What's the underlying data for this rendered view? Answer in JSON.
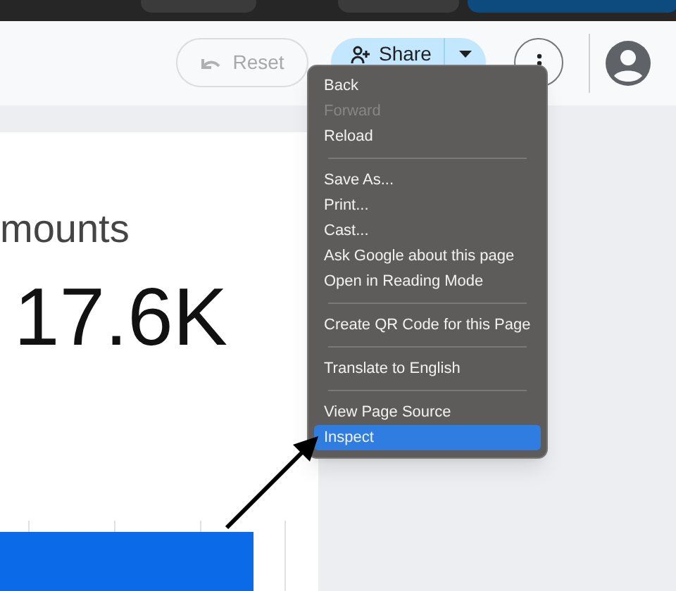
{
  "toolbar": {
    "reset_button": {
      "label": "Reset",
      "disabled": true
    },
    "share_button": {
      "label": "Share"
    }
  },
  "scorecard": {
    "title": "mounts",
    "value": "17.6K"
  },
  "context_menu": [
    {
      "kind": "item",
      "label": "Back",
      "disabled": false,
      "selected": false
    },
    {
      "kind": "item",
      "label": "Forward",
      "disabled": true,
      "selected": false
    },
    {
      "kind": "item",
      "label": "Reload",
      "disabled": false,
      "selected": false
    },
    {
      "kind": "separator"
    },
    {
      "kind": "item",
      "label": "Save As...",
      "disabled": false,
      "selected": false
    },
    {
      "kind": "item",
      "label": "Print...",
      "disabled": false,
      "selected": false
    },
    {
      "kind": "item",
      "label": "Cast...",
      "disabled": false,
      "selected": false
    },
    {
      "kind": "item",
      "label": "Ask Google about this page",
      "disabled": false,
      "selected": false
    },
    {
      "kind": "item",
      "label": "Open in Reading Mode",
      "disabled": false,
      "selected": false
    },
    {
      "kind": "separator"
    },
    {
      "kind": "item",
      "label": "Create QR Code for this Page",
      "disabled": false,
      "selected": false
    },
    {
      "kind": "separator"
    },
    {
      "kind": "item",
      "label": "Translate to English",
      "disabled": false,
      "selected": false
    },
    {
      "kind": "separator"
    },
    {
      "kind": "item",
      "label": "View Page Source",
      "disabled": false,
      "selected": false
    },
    {
      "kind": "item",
      "label": "Inspect",
      "disabled": false,
      "selected": true
    }
  ]
}
